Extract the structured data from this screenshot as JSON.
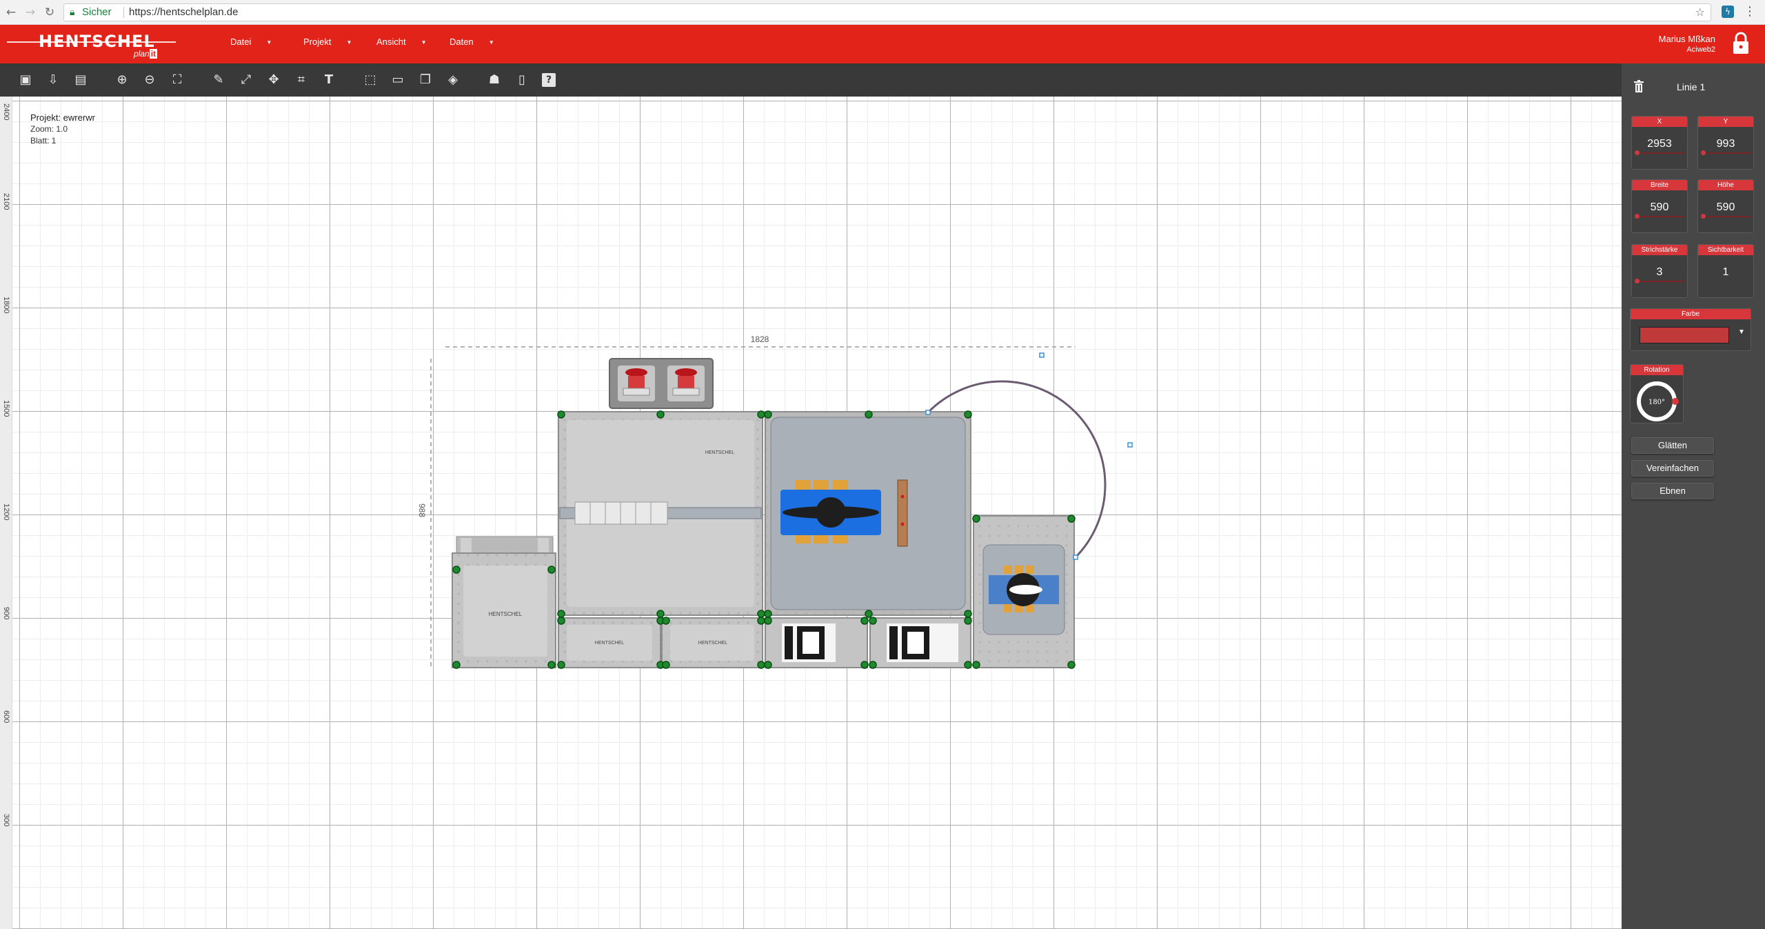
{
  "browser": {
    "secure_label": "Sicher",
    "url": "https://hentschelplan.de"
  },
  "header": {
    "brand": "HENTSCHEL",
    "sub": "plan",
    "sub_suffix": "it",
    "menus": [
      {
        "label": "Datei"
      },
      {
        "label": "Projekt"
      },
      {
        "label": "Ansicht"
      },
      {
        "label": "Daten"
      }
    ],
    "user_name": "Marius Mßkan",
    "user_org": "Aciweb2",
    "accent": "#e2231a"
  },
  "toolbar": {
    "tools": [
      "save-icon",
      "import-icon",
      "export-icon",
      "zoom-in-icon",
      "zoom-out-icon",
      "zoom-fit-icon",
      "draw-icon",
      "line-icon",
      "move-icon",
      "transform-icon",
      "text-icon",
      "select-icon",
      "ruler-icon",
      "copy-icon",
      "fill-icon",
      "user-icon",
      "book-icon",
      "help-icon"
    ]
  },
  "canvas": {
    "project_label": "Projekt: ewrerwr",
    "zoom_label": "Zoom: 1.0",
    "sheet_label": "Blatt: 1",
    "ruler_labels": [
      "2400",
      "2100",
      "1800",
      "1500",
      "1200",
      "900",
      "600",
      "300"
    ],
    "dim_width": "1828",
    "dim_height": "988",
    "panel_brand": "HENTSCHEL"
  },
  "panel": {
    "title": "Linie 1",
    "props": [
      {
        "label": "X",
        "value": "2953",
        "level": 0.0
      },
      {
        "label": "Y",
        "value": "993",
        "level": 0.0
      },
      {
        "label": "Breite",
        "value": "590",
        "level": 0.0
      },
      {
        "label": "Höhe",
        "value": "590",
        "level": 0.0
      },
      {
        "label": "Strichstärke",
        "value": "3",
        "level": 0.0
      },
      {
        "label": "Sichtbarkeit",
        "value": "1",
        "level": 1.0
      }
    ],
    "color_label": "Farbe",
    "color_value": "#c0393b",
    "rotation_label": "Rotation",
    "rotation_value": "180°",
    "buttons": [
      "Glätten",
      "Vereinfachen",
      "Ebnen"
    ]
  }
}
